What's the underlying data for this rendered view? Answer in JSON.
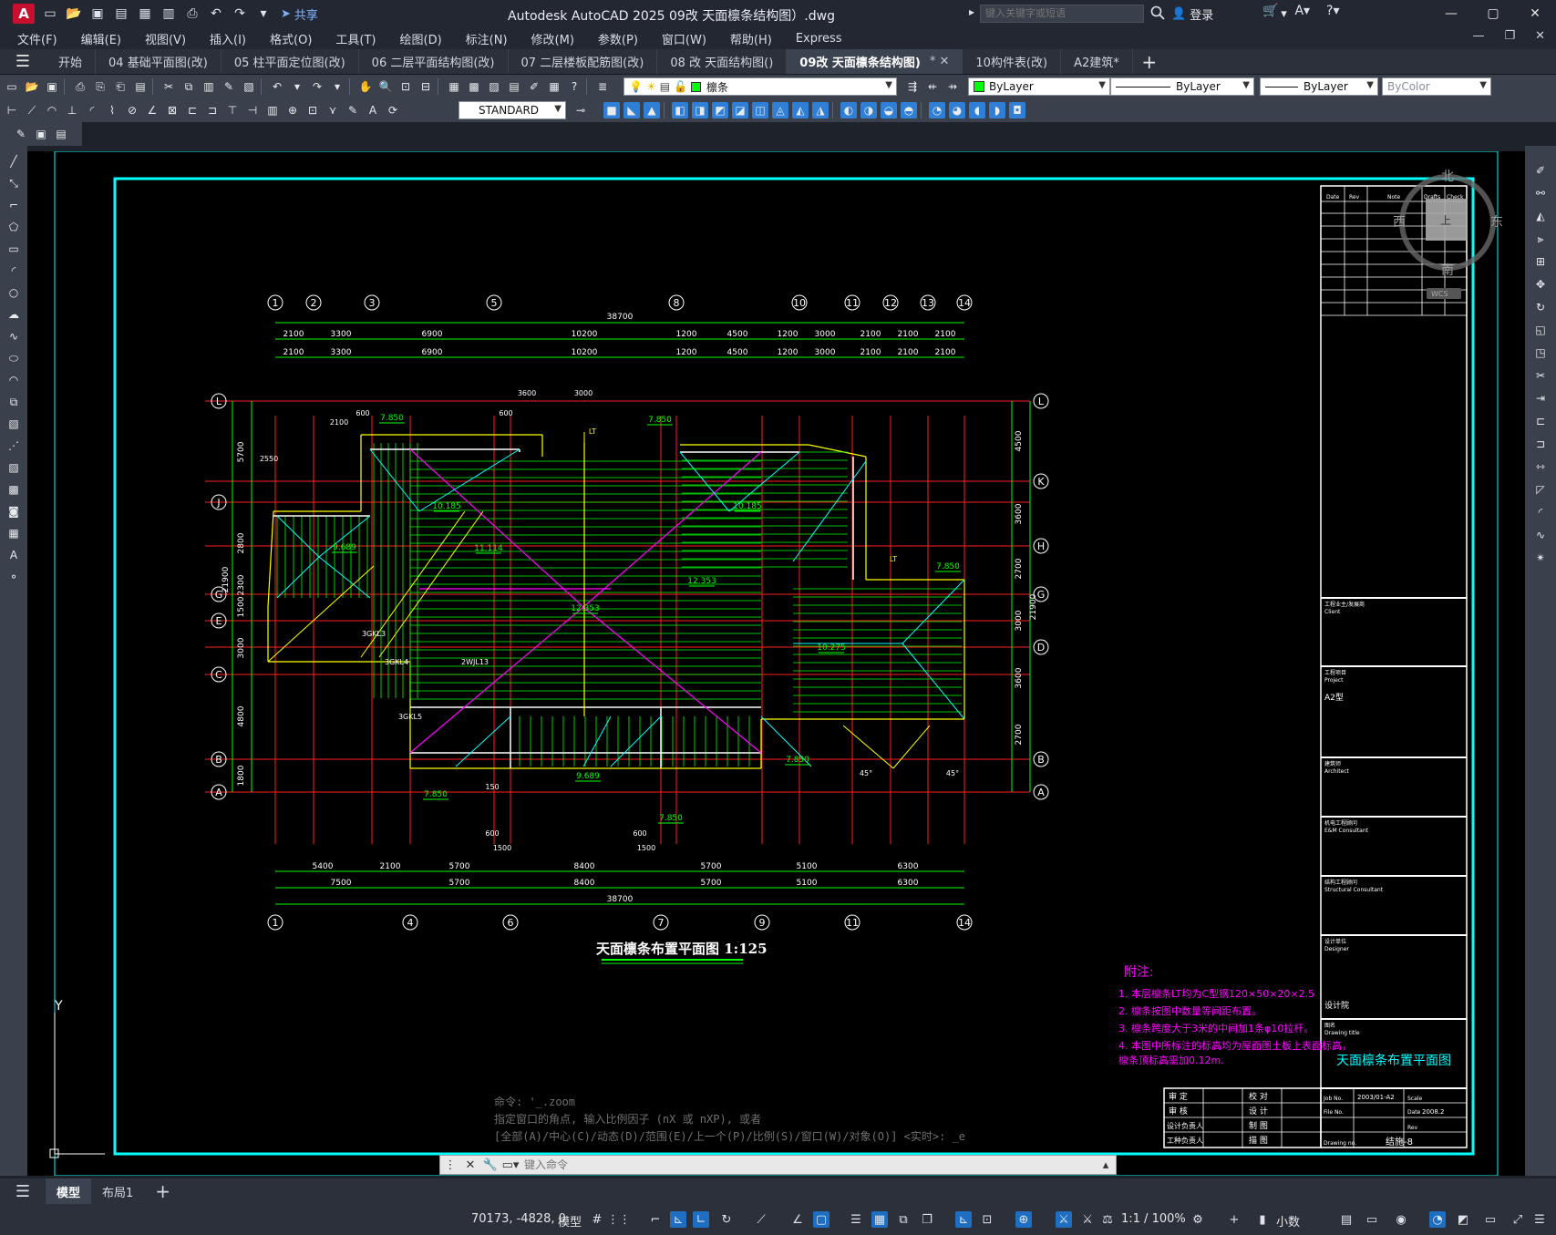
{
  "titlebar": {
    "app_logo": "A",
    "share": "共享",
    "title": "Autodesk AutoCAD 2025    09改 天面檩条结构图）.dwg",
    "search_placeholder": "键入关键字或短语",
    "login": "登录"
  },
  "menu": [
    "文件(F)",
    "编辑(E)",
    "视图(V)",
    "插入(I)",
    "格式(O)",
    "工具(T)",
    "绘图(D)",
    "标注(N)",
    "修改(M)",
    "参数(P)",
    "窗口(W)",
    "帮助(H)",
    "Express"
  ],
  "tabs": [
    {
      "label": "开始"
    },
    {
      "label": "04 基础平面图(改)"
    },
    {
      "label": "05 柱平面定位图(改)"
    },
    {
      "label": "06 二层平面结构图(改)"
    },
    {
      "label": "07 二层楼板配筋图(改)"
    },
    {
      "label": "08 改 天面结构图()"
    },
    {
      "label": "09改 天面檩条结构图)",
      "active": true,
      "close": "*  ✕"
    },
    {
      "label": "10构件表(改)"
    },
    {
      "label": "A2建筑*"
    }
  ],
  "toolbar": {
    "layer": "檩条",
    "color": "ByLayer",
    "linetype": "ByLayer",
    "lineweight": "ByLayer",
    "plotstyle": "ByColor",
    "textstyle": "STANDARD"
  },
  "drawing": {
    "grid_top": [
      "1",
      "2",
      "3",
      "5",
      "8",
      "10",
      "11",
      "12",
      "13",
      "14"
    ],
    "grid_bottom": [
      "1",
      "4",
      "6",
      "7",
      "9",
      "11",
      "14"
    ],
    "grid_left": [
      "L",
      "J",
      "G",
      "E",
      "C",
      "B",
      "A"
    ],
    "grid_right": [
      "L",
      "K",
      "H",
      "G",
      "D",
      "B",
      "A"
    ],
    "dim_top_total": "38700",
    "dim_top_row1": [
      "2100",
      "3300",
      "6900",
      "10200",
      "1200",
      "4500",
      "1200",
      "3000",
      "2100",
      "2100",
      "2100"
    ],
    "dim_top_row2": [
      "2100",
      "3300",
      "6900",
      "10200",
      "1200",
      "4500",
      "1200",
      "3000",
      "2100",
      "2100",
      "2100"
    ],
    "dim_bottom_row1": [
      "5400",
      "2100",
      "5700",
      "8400",
      "5700",
      "5100",
      "6300"
    ],
    "dim_bottom_row2": [
      "7500",
      "5700",
      "8400",
      "5700",
      "5100",
      "6300"
    ],
    "dim_bottom_total": "38700",
    "dim_left": [
      "5700",
      "2800",
      "2300",
      "1500",
      "3000",
      "4800",
      "1800"
    ],
    "dim_left_total": "21900",
    "dim_right": [
      "4500",
      "3600",
      "2700",
      "3000",
      "3600",
      "2700"
    ],
    "dim_right_total": "21900",
    "elevations": [
      "7.850",
      "7.850",
      "7.850",
      "7.850",
      "7.850",
      "7.850",
      "10.185",
      "10.185",
      "9.689",
      "11.114",
      "12.353",
      "12.353",
      "10.275",
      "9.689"
    ],
    "labels_misc": [
      "600",
      "2550",
      "2100",
      "600",
      "3600",
      "3000",
      "LT",
      "LT",
      "3GKL3",
      "3GKL4",
      "2WJL13",
      "3GKL5",
      "1500",
      "1500",
      "600",
      "600",
      "150",
      "45°",
      "45°"
    ],
    "plan_title": "天面檩条布置平面图 1:125",
    "notes_title": "附注:",
    "notes": [
      "1. 本层檩条LT均为C型钢120×50×20×2.5",
      "2. 檩条按图中数量等间距布置。",
      "3. 檩条跨度大于3米的中间加1条φ10拉杆。",
      "4. 本图中所标注的标高均为屋面图土板上表面标高，",
      "    檩条顶标高需加0.12m."
    ]
  },
  "titleblock": {
    "rev_headers": [
      "Date",
      "Rev",
      "Note",
      "Drafts",
      "Check"
    ],
    "client_label": "工程业主/发展商",
    "client_en": "Client",
    "project_label": "工程项目",
    "project_en": "Project",
    "project_value": "A2型",
    "architect_label": "建筑师",
    "architect_en": "Architect",
    "em_label": "机电工程顾问",
    "em_en": "E&M Consultant",
    "struct_label": "结构工程顾问",
    "struct_en": "Structural Consultant",
    "designer_label": "设计单位",
    "designer_en": "Designer",
    "designer_value": "设计院",
    "drawing_title_label": "图名",
    "drawing_title_en": "Drawing title",
    "drawing_title_value": "天面檩条布置平面图",
    "sign_rows": [
      [
        "审 定",
        "校 对"
      ],
      [
        "审 核",
        "设 计"
      ],
      [
        "设计负责人",
        "制 图"
      ],
      [
        "工种负责人",
        "描 图"
      ]
    ],
    "job_no_label": "Job No.",
    "job_no": "2003/01-A2",
    "scale_label": "Scale",
    "file_no_label": "File No.",
    "date_label": "Date",
    "date": "2008.2",
    "rev_label": "Rev",
    "drawing_no_label": "Drawing no.",
    "drawing_no": "结施-8"
  },
  "viewcube": {
    "n": "北",
    "s": "南",
    "e": "东",
    "w": "西",
    "top": "上",
    "wcs": "WCS"
  },
  "ucs": {
    "y": "Y"
  },
  "command": {
    "history": [
      "命令: '_.zoom",
      "指定窗口的角点, 输入比例因子 (nX 或 nXP), 或者",
      "[全部(A)/中心(C)/动态(D)/范围(E)/上一个(P)/比例(S)/窗口(W)/对象(O)] <实时>: _e"
    ],
    "placeholder": "键入命令"
  },
  "layouts": [
    {
      "label": "模型",
      "active": true
    },
    {
      "label": "布局1"
    }
  ],
  "status": {
    "coord": "70173, -4828, 0",
    "mode": "模型",
    "scale": "1:1 / 100%",
    "units": "小数"
  },
  "colors": {
    "grid_red": "#ff2020",
    "green": "#00ff00",
    "cyan": "#00ffff",
    "magenta": "#ff00ff",
    "yellow": "#ffff00",
    "white": "#ffffff",
    "blue": "#4080ff"
  }
}
